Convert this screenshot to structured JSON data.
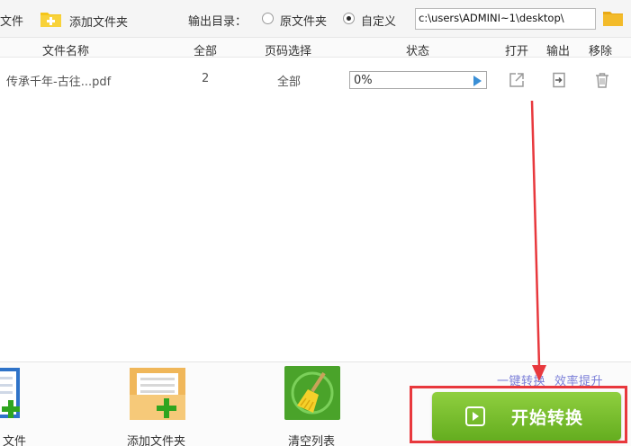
{
  "toolbar": {
    "add_file_label": "文件",
    "add_folder_label": "添加文件夹",
    "output_dir_label": "输出目录：",
    "radio_original_label": "原文件夹",
    "radio_custom_label": "自定义",
    "output_path": "c:\\users\\ADMINI~1\\desktop\\",
    "selected_option": "自定义"
  },
  "table": {
    "headers": {
      "name": "文件名称",
      "total": "全部",
      "page_select": "页码选择",
      "status": "状态",
      "open": "打开",
      "output": "输出",
      "remove": "移除"
    },
    "rows": [
      {
        "name": "传承千年-古往...pdf",
        "total": "2",
        "page_select": "全部",
        "progress_text": "0%",
        "progress": 0
      }
    ]
  },
  "bottom": {
    "add_file_label": "文件",
    "add_folder_label": "添加文件夹",
    "clear_list_label": "清空列表",
    "slogan_left": "一键转换",
    "slogan_right": "效率提升",
    "start_button_label": "开始转换"
  },
  "colors": {
    "start_button": "#6fb829",
    "highlight": "#e8383d",
    "slogan": "#7b7fd8",
    "progress_play": "#3a8fd6"
  },
  "icons": {
    "folder_add": "folder-plus-icon",
    "browse": "folder-icon",
    "open": "external-link-icon",
    "output": "export-icon",
    "remove": "trash-icon",
    "clear": "broom-icon",
    "play": "play-icon"
  }
}
